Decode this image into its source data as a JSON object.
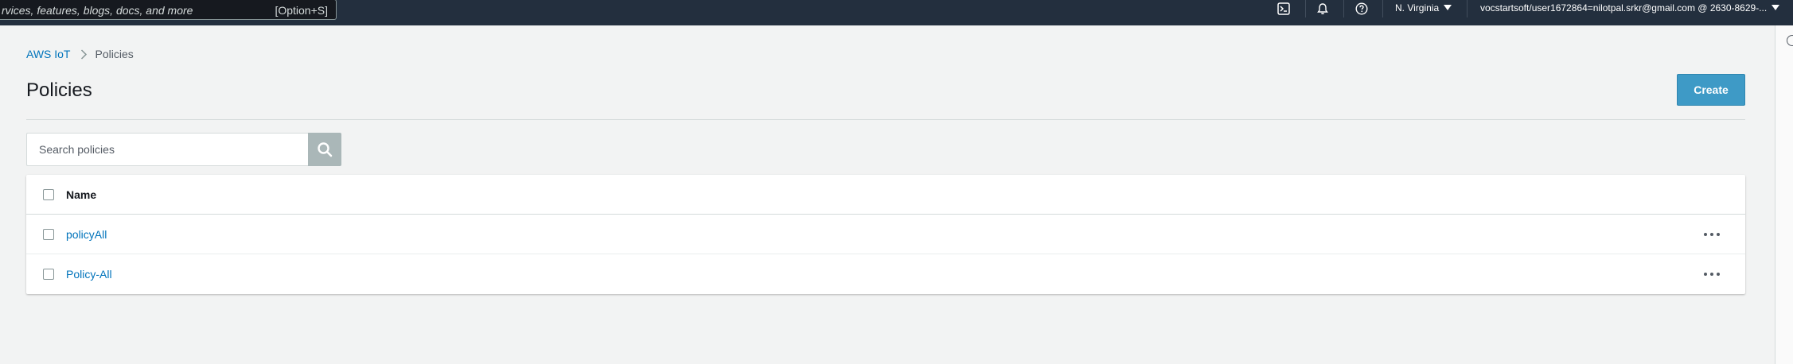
{
  "topbar": {
    "search_placeholder": "rvices, features, blogs, docs, and more",
    "search_shortcut": "[Option+S]",
    "icons": [
      "cloudshell-icon",
      "bell-icon",
      "help-icon"
    ],
    "region": "N. Virginia",
    "account": "vocstartsoft/user1672864=nilotpal.srkr@gmail.com @ 2630-8629-..."
  },
  "breadcrumb": {
    "root": "AWS IoT",
    "current": "Policies"
  },
  "page": {
    "title": "Policies",
    "create_label": "Create"
  },
  "search": {
    "placeholder": "Search policies"
  },
  "table": {
    "header_name": "Name",
    "rows": [
      {
        "name": "policyAll"
      },
      {
        "name": "Policy-All"
      }
    ]
  },
  "colors": {
    "topbar": "#232f3e",
    "accent_link": "#0073bb",
    "primary_button": "#3e9ac6",
    "page_bg": "#f2f3f3"
  }
}
